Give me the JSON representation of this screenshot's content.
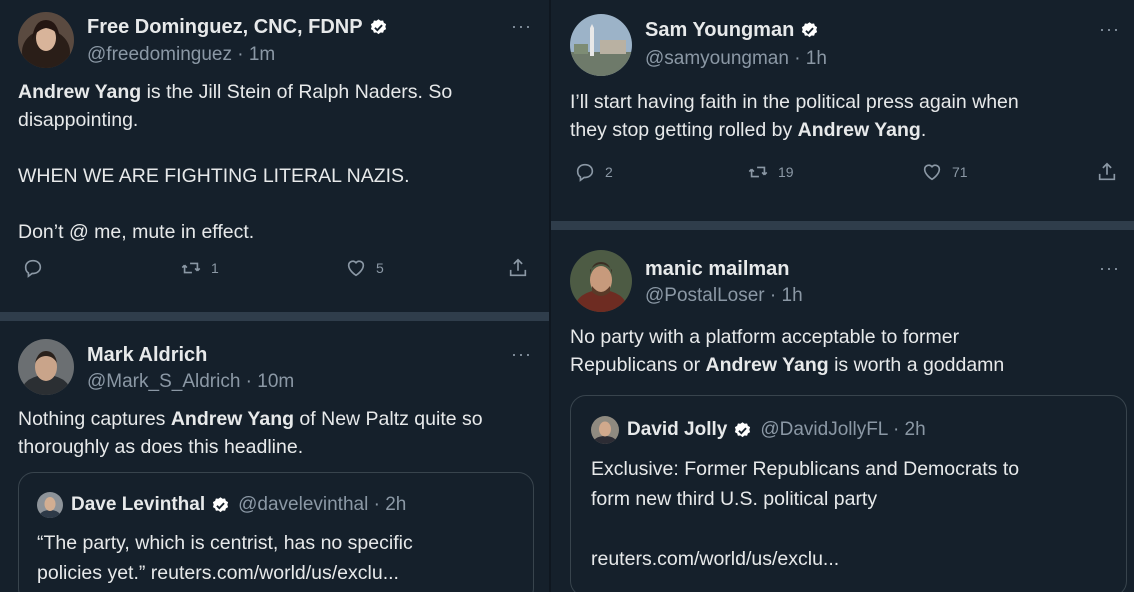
{
  "colors": {
    "background": "#15202b",
    "text": "#e7e9ea",
    "muted": "#8b98a5",
    "verified": "#ffffff",
    "separator": "#2f3d4b"
  },
  "icons": {
    "reply": "reply-icon",
    "retweet": "retweet-icon",
    "like": "heart-icon",
    "share": "share-icon",
    "more": "more-icon",
    "verified": "verified-badge-icon"
  },
  "more_label": "···",
  "tweets": [
    {
      "name": "Free Dominguez, CNC, FDNP",
      "verified": true,
      "handle": "@freedominguez · 1m",
      "body": [
        {
          "bold": "Andrew Yang",
          "rest": " is the Jill Stein of Ralph Naders.  So"
        },
        {
          "plain": "disappointing."
        },
        {
          "plain": "WHEN WE ARE FIGHTING LITERAL NAZIS."
        },
        {
          "plain": "Don’t @ me, mute in effect."
        }
      ],
      "reply_count": "",
      "retweet_count": "1",
      "like_count": "5"
    },
    {
      "name": "Mark Aldrich",
      "handle": "@Mark_S_Aldrich · 10m",
      "body": [
        {
          "pre": "Nothing captures ",
          "bold": "Andrew Yang",
          "rest": " of New Paltz quite so"
        },
        {
          "plain": "thoroughly as does this headline."
        }
      ],
      "quote": {
        "name": "Dave Levinthal",
        "verified": true,
        "handle": "@davelevinthal · 2h",
        "lines": [
          "“The party, which is centrist, has no specific",
          "policies yet.” reuters.com/world/us/exclu..."
        ]
      }
    },
    {
      "name": "Sam Youngman",
      "verified": true,
      "handle": "@samyoungman · 1h",
      "body": [
        {
          "plain": "I’ll start having faith in the political press again when"
        },
        {
          "pre": "they stop getting rolled by ",
          "bold": "Andrew Yang",
          "rest": "."
        }
      ],
      "reply_count": "2",
      "retweet_count": "19",
      "like_count": "71"
    },
    {
      "name": "manic mailman",
      "handle": "@PostalLoser · 1h",
      "body": [
        {
          "plain": "No party with a platform acceptable to former"
        },
        {
          "pre": "Republicans or ",
          "bold": "Andrew Yang",
          "rest": " is worth a goddamn"
        }
      ],
      "quote": {
        "name": "David Jolly",
        "verified": true,
        "handle": "@DavidJollyFL · 2h",
        "lines": [
          "Exclusive: Former Republicans and Democrats to",
          "form new third U.S. political party",
          "reuters.com/world/us/exclu..."
        ]
      }
    }
  ]
}
